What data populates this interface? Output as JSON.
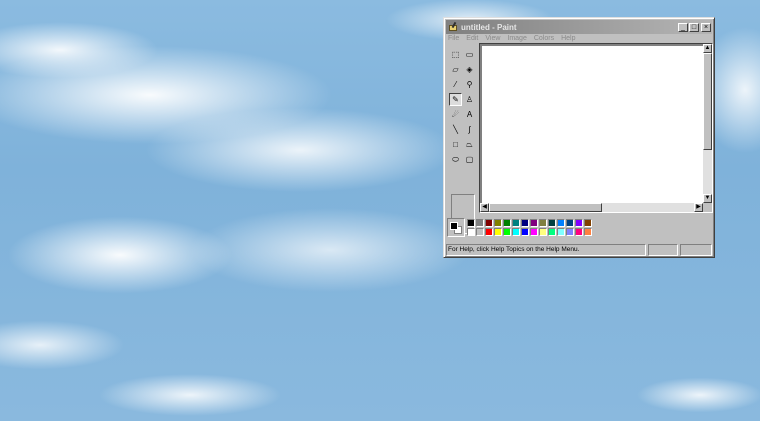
{
  "window": {
    "title": "untitled - Paint",
    "minimize_label": "_",
    "maximize_label": "□",
    "close_label": "×"
  },
  "menu": [
    "File",
    "Edit",
    "View",
    "Image",
    "Colors",
    "Help"
  ],
  "tools": [
    {
      "name": "free-form-select-tool",
      "glyph": "⬚"
    },
    {
      "name": "select-tool",
      "glyph": "▭"
    },
    {
      "name": "eraser-tool",
      "glyph": "▱"
    },
    {
      "name": "fill-tool",
      "glyph": "◈"
    },
    {
      "name": "pick-color-tool",
      "glyph": "⁄"
    },
    {
      "name": "magnifier-tool",
      "glyph": "⚲"
    },
    {
      "name": "pencil-tool",
      "glyph": "✎"
    },
    {
      "name": "brush-tool",
      "glyph": "♙"
    },
    {
      "name": "airbrush-tool",
      "glyph": "☄"
    },
    {
      "name": "text-tool",
      "glyph": "A"
    },
    {
      "name": "line-tool",
      "glyph": "╲"
    },
    {
      "name": "curve-tool",
      "glyph": "∫"
    },
    {
      "name": "rectangle-tool",
      "glyph": "□"
    },
    {
      "name": "polygon-tool",
      "glyph": "⏢"
    },
    {
      "name": "ellipse-tool",
      "glyph": "⬭"
    },
    {
      "name": "rounded-rectangle-tool",
      "glyph": "▢"
    }
  ],
  "selected_tool": "pencil-tool",
  "palette": {
    "foreground": "#000000",
    "background": "#ffffff",
    "row1": [
      "#000000",
      "#808080",
      "#800000",
      "#808000",
      "#008000",
      "#008080",
      "#000080",
      "#800080",
      "#808040",
      "#004040",
      "#0080ff",
      "#004080",
      "#8000ff",
      "#804000"
    ],
    "row2": [
      "#ffffff",
      "#c0c0c0",
      "#ff0000",
      "#ffff00",
      "#00ff00",
      "#00ffff",
      "#0000ff",
      "#ff00ff",
      "#ffff80",
      "#00ff80",
      "#80ffff",
      "#8080ff",
      "#ff0080",
      "#ff8040"
    ]
  },
  "status": {
    "help_text": "For Help, click Help Topics on the Help Menu."
  }
}
